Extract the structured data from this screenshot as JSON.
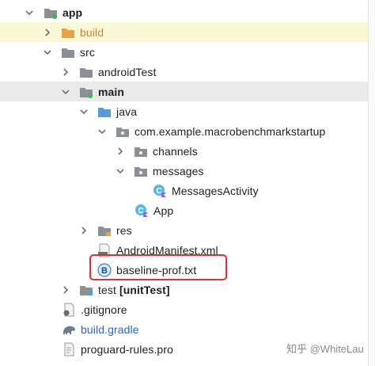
{
  "tree": {
    "app": "app",
    "build": "build",
    "src": "src",
    "androidTest": "androidTest",
    "main": "main",
    "java": "java",
    "package": "com.example.macrobenchmarkstartup",
    "channels": "channels",
    "messages": "messages",
    "messages_activity": "MessagesActivity",
    "app_class": "App",
    "res": "res",
    "manifest": "AndroidManifest.xml",
    "baseline": "baseline-prof.txt",
    "test_name": "test",
    "test_suffix": "[unitTest]",
    "gitignore": ".gitignore",
    "build_gradle": "build.gradle",
    "proguard": "proguard-rules.pro"
  },
  "watermark": "知乎 @WhiteLau",
  "colors": {
    "folder_gray": "#8c9096",
    "folder_orange": "#e8a24a",
    "folder_blue": "#5b9bd5",
    "highlight": "#e0303a",
    "class_icon": "#58b9e8",
    "kotlin_accent": "#9b5de5"
  }
}
